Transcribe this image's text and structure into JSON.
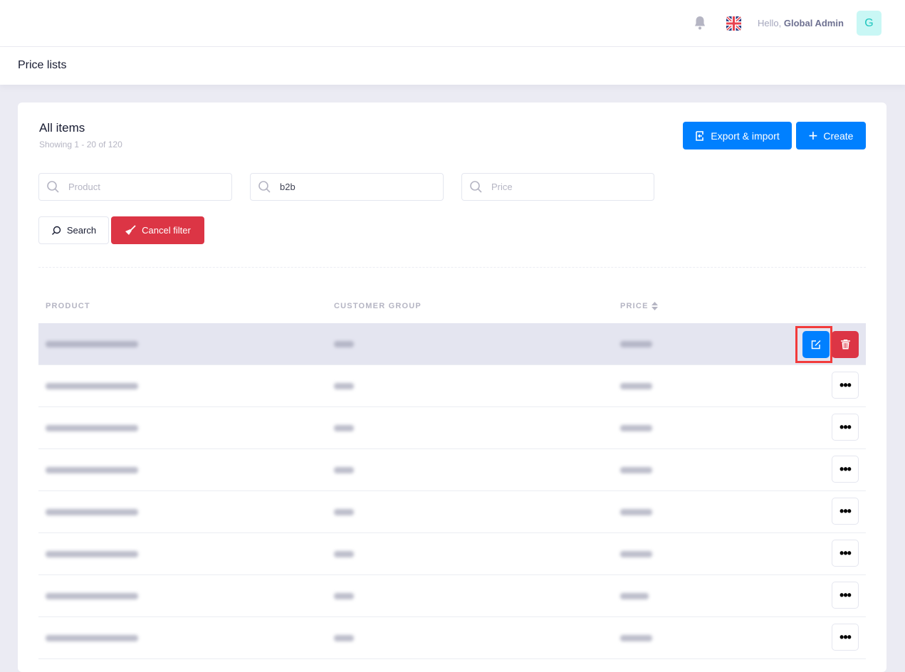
{
  "header": {
    "greeting": "Hello,",
    "user_name": "Global Admin",
    "avatar_initial": "G"
  },
  "page_title": "Price lists",
  "card": {
    "title": "All items",
    "showing": "Showing 1 - 20 of 120",
    "export_label": "Export & import",
    "create_label": "Create"
  },
  "filters": {
    "product_placeholder": "Product",
    "group_value": "b2b",
    "price_placeholder": "Price",
    "search_label": "Search",
    "cancel_label": "Cancel filter"
  },
  "table": {
    "columns": [
      "PRODUCT",
      "CUSTOMER GROUP",
      "PRICE"
    ],
    "sortable_column": "PRICE",
    "row_count_visible": 8,
    "more_label": "•••"
  },
  "colors": {
    "primary": "#0080ff",
    "danger": "#dc3545",
    "avatar_bg": "#c9f7f5",
    "highlight": "#e4e5f0"
  }
}
